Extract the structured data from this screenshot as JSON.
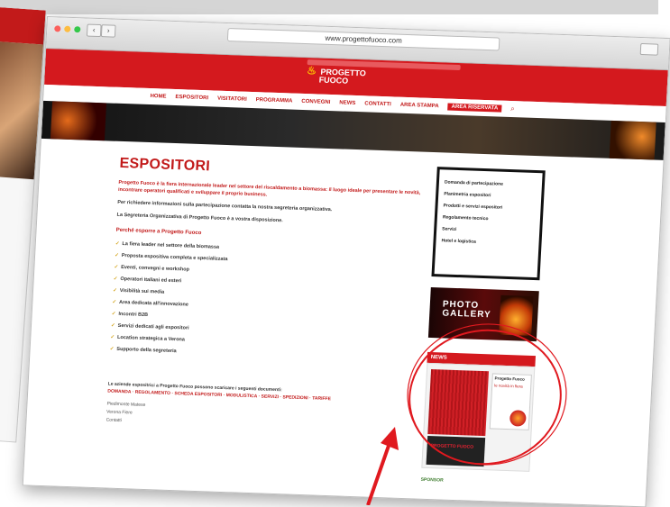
{
  "browser": {
    "url": "www.progettofuoco.com",
    "back_label": "‹",
    "forward_label": "›"
  },
  "site": {
    "logo_top": "PROGETTO",
    "logo_bottom": "FUOCO",
    "nav": [
      "HOME",
      "ESPOSITORI",
      "VISITATORI",
      "PROGRAMMA",
      "CONVEGNI",
      "NEWS",
      "CONTATTI",
      "AREA STAMPA",
      "AREA RISERVATA"
    ],
    "nav_active_index": 8
  },
  "main": {
    "title": "ESPOSITORI",
    "intro": "Progetto Fuoco è la fiera internazionale leader nel settore del riscaldamento a biomassa: il luogo ideale per presentare le novità, incontrare operatori qualificati e sviluppare il proprio business.",
    "intro2": "Per richiedere informazioni sulla partecipazione contatta la nostra segreteria organizzativa.",
    "intro3": "La Segreteria Organizzativa di Progetto Fuoco è a vostra disposizione.",
    "reasons_title": "Perché esporre a Progetto Fuoco",
    "reasons": [
      "La fiera leader nel settore della biomassa",
      "Proposta espositiva completa e specializzata",
      "Eventi, convegni e workshop",
      "Operatori italiani ed esteri",
      "Visibilità sui media",
      "Area dedicata all'innovazione",
      "Incontri B2B",
      "Servizi dedicati agli espositori",
      "Location strategica a Verona",
      "Supporto della segreteria"
    ],
    "footer_text": "Le aziende espositrici a Progetto Fuoco possono scaricare i seguenti documenti:",
    "footer_links": "DOMANDA · REGOLAMENTO · SCHEDA ESPOSITORI · MODULISTICA · SERVIZI · SPEDIZIONI · TARIFFE",
    "footer_small": [
      "Piedimonte Matese",
      "Verona Fiere",
      "Contatti"
    ]
  },
  "sidebar": {
    "links": [
      "Domanda di partecipazione",
      "Planimetria espositori",
      "Prodotti e servizi espositori",
      "Regolamento tecnico",
      "Servizi",
      "Hotel e logistica"
    ],
    "gallery_line1": "PHOTO",
    "gallery_line2": "GALLERY",
    "news_label": "NEWS",
    "news_title": "Progetto Fuoco",
    "news_sub": "le novità in fiera",
    "news_logo": "PROGETTO FUOCO",
    "sponsor": "SPONSOR"
  },
  "colors": {
    "brand_red": "#d4191e",
    "annotation_red": "#e0191f"
  }
}
